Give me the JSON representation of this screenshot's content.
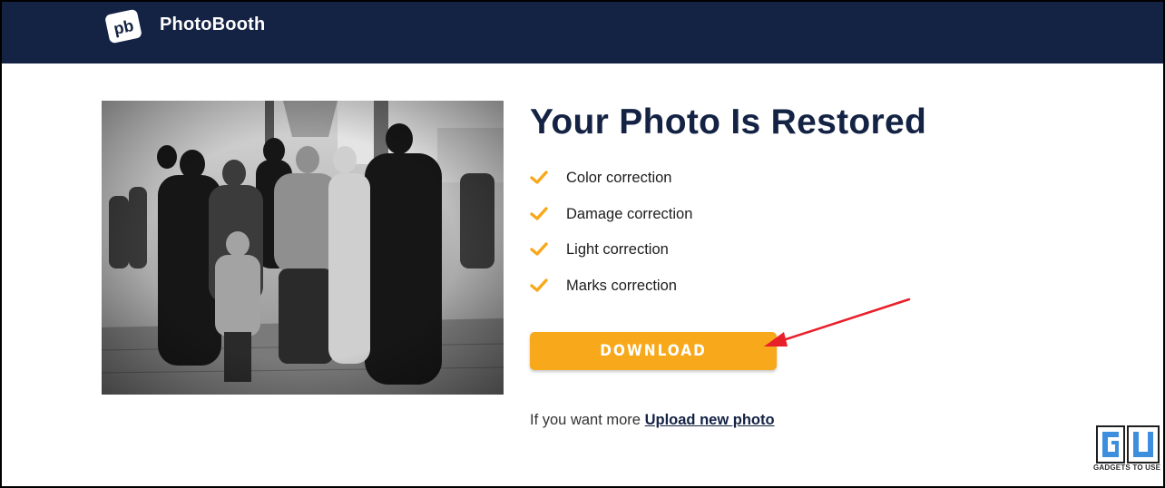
{
  "header": {
    "logo_text": "pb",
    "brand": "PhotoBooth"
  },
  "colors": {
    "header_bg": "#142344",
    "accent": "#f7a81b",
    "title": "#142344",
    "arrow": "#e8202a"
  },
  "main": {
    "photo": {
      "icon": "restored-photo-image"
    },
    "title": "Your Photo Is Restored",
    "features": [
      {
        "label": "Color correction",
        "icon": "check-icon"
      },
      {
        "label": "Damage correction",
        "icon": "check-icon"
      },
      {
        "label": "Light correction",
        "icon": "check-icon"
      },
      {
        "label": "Marks correction",
        "icon": "check-icon"
      }
    ],
    "download_label": "DOWNLOAD",
    "more_text": "If you want more",
    "upload_link": "Upload new photo"
  },
  "watermark": {
    "text": "GADGETS TO USE"
  }
}
